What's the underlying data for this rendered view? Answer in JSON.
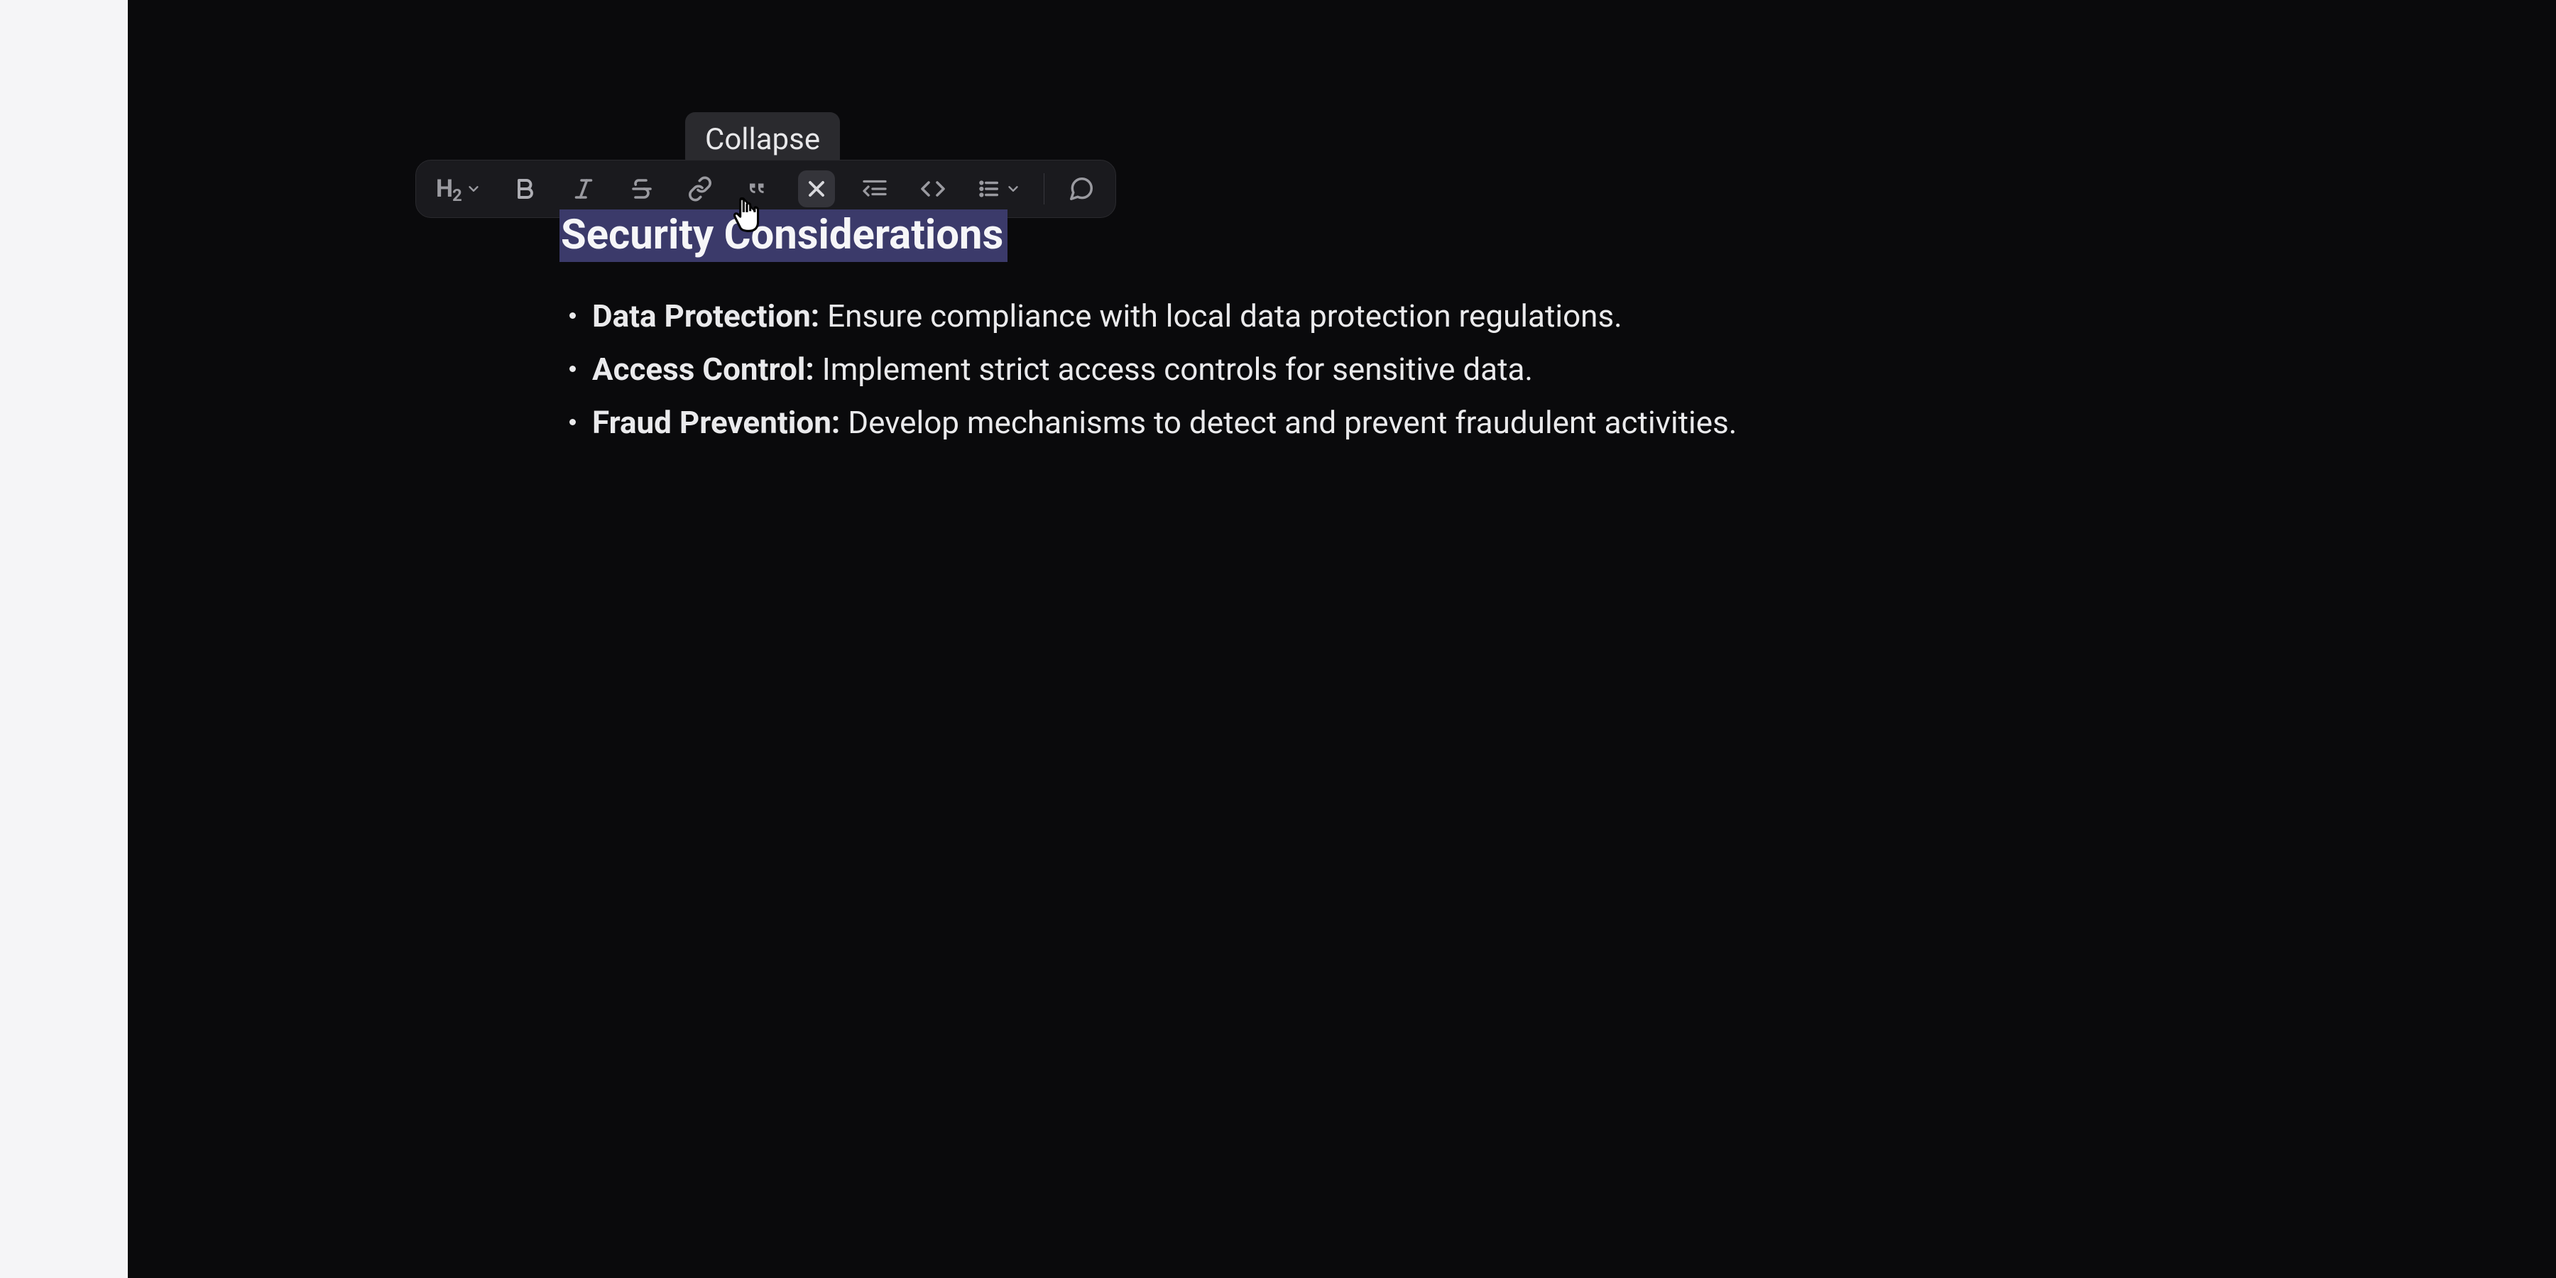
{
  "tooltip": {
    "label": "Collapse"
  },
  "toolbar": {
    "heading_label": "H₂",
    "items": [
      {
        "name": "heading"
      },
      {
        "name": "bold"
      },
      {
        "name": "italic"
      },
      {
        "name": "strikethrough"
      },
      {
        "name": "link"
      },
      {
        "name": "quote"
      },
      {
        "name": "collapse",
        "active": true
      },
      {
        "name": "code-block"
      },
      {
        "name": "inline-code"
      },
      {
        "name": "list"
      },
      {
        "name": "comment"
      }
    ]
  },
  "content": {
    "heading": "Security Considerations",
    "bullets": [
      {
        "label": "Data Protection:",
        "text": " Ensure compliance with local data protection regulations."
      },
      {
        "label": "Access Control:",
        "text": " Implement strict access controls for sensitive data."
      },
      {
        "label": "Fraud Prevention:",
        "text": " Develop mechanisms to detect and prevent fraudulent activities."
      }
    ]
  },
  "colors": {
    "background": "#0a0a0c",
    "toolbar_bg": "#1a1a1e",
    "tooltip_bg": "#2a2a2e",
    "selection_bg": "#3b3a6a",
    "text": "#f0f0f2",
    "icon": "#9a9aa0"
  }
}
